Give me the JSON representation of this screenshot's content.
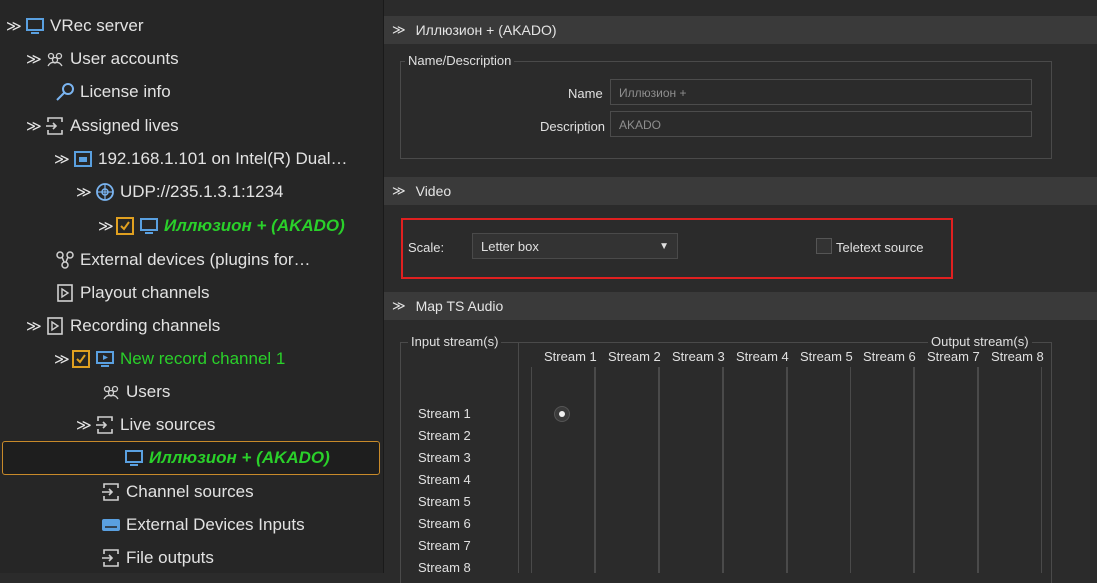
{
  "sidebar": {
    "items": [
      {
        "label": "VRec server",
        "icon": "monitor-icon",
        "chevron": "expanded"
      },
      {
        "label": "User accounts",
        "icon": "users-icon",
        "chevron": "collapsed"
      },
      {
        "label": "License info",
        "icon": "key-icon"
      },
      {
        "label": "Assigned lives",
        "icon": "io-icon",
        "chevron": "expanded"
      },
      {
        "label": "192.168.1.101 on Intel(R) Dual…",
        "icon": "network-card-icon",
        "chevron": "expanded"
      },
      {
        "label": "UDP://235.1.3.1:1234",
        "icon": "globe-icon",
        "chevron": "expanded"
      },
      {
        "label": "Иллюзион + (AKADO)",
        "icon": "monitor-icon",
        "chevron": "collapsed",
        "checked": true
      },
      {
        "label": "External devices (plugins for…",
        "icon": "plugin-icon"
      },
      {
        "label": "Playout channels",
        "icon": "channel-icon"
      },
      {
        "label": "Recording channels",
        "icon": "channel-icon",
        "chevron": "expanded"
      },
      {
        "label": "New record channel 1",
        "icon": "record-channel-icon",
        "chevron": "expanded",
        "checked": true
      },
      {
        "label": "Users",
        "icon": "users-icon"
      },
      {
        "label": "Live sources",
        "icon": "io-icon",
        "chevron": "expanded"
      },
      {
        "label": "Иллюзион + (AKADO)",
        "icon": "monitor-icon",
        "selected": true
      },
      {
        "label": "Channel sources",
        "icon": "io-icon"
      },
      {
        "label": "External Devices Inputs",
        "icon": "keyboard-icon"
      },
      {
        "label": "File outputs",
        "icon": "io-icon"
      }
    ]
  },
  "main": {
    "header_title": "Иллюзион + (AKADO)",
    "name_description": {
      "legend": "Name/Description",
      "name_label": "Name",
      "name_value": "Иллюзион +",
      "description_label": "Description",
      "description_value": "AKADO"
    },
    "video": {
      "header": "Video",
      "scale_label": "Scale:",
      "scale_value": "Letter box",
      "teletext_label": "Teletext source",
      "teletext_checked": false
    },
    "map_ts_audio": {
      "header": "Map TS Audio",
      "input_legend": "Input stream(s)",
      "output_legend": "Output stream(s)",
      "columns": [
        "Stream 1",
        "Stream 2",
        "Stream 3",
        "Stream 4",
        "Stream 5",
        "Stream 6",
        "Stream 7",
        "Stream 8"
      ],
      "rows": [
        "Stream 1",
        "Stream 2",
        "Stream 3",
        "Stream 4",
        "Stream 5",
        "Stream 6",
        "Stream 7",
        "Stream 8"
      ],
      "selected": {
        "row": 1,
        "column": 1
      }
    }
  },
  "colors": {
    "accent_green": "#2ad02a",
    "checkbox_orange": "#e0a020",
    "highlight_red": "#e02020",
    "selection_border": "#c88a2a"
  }
}
